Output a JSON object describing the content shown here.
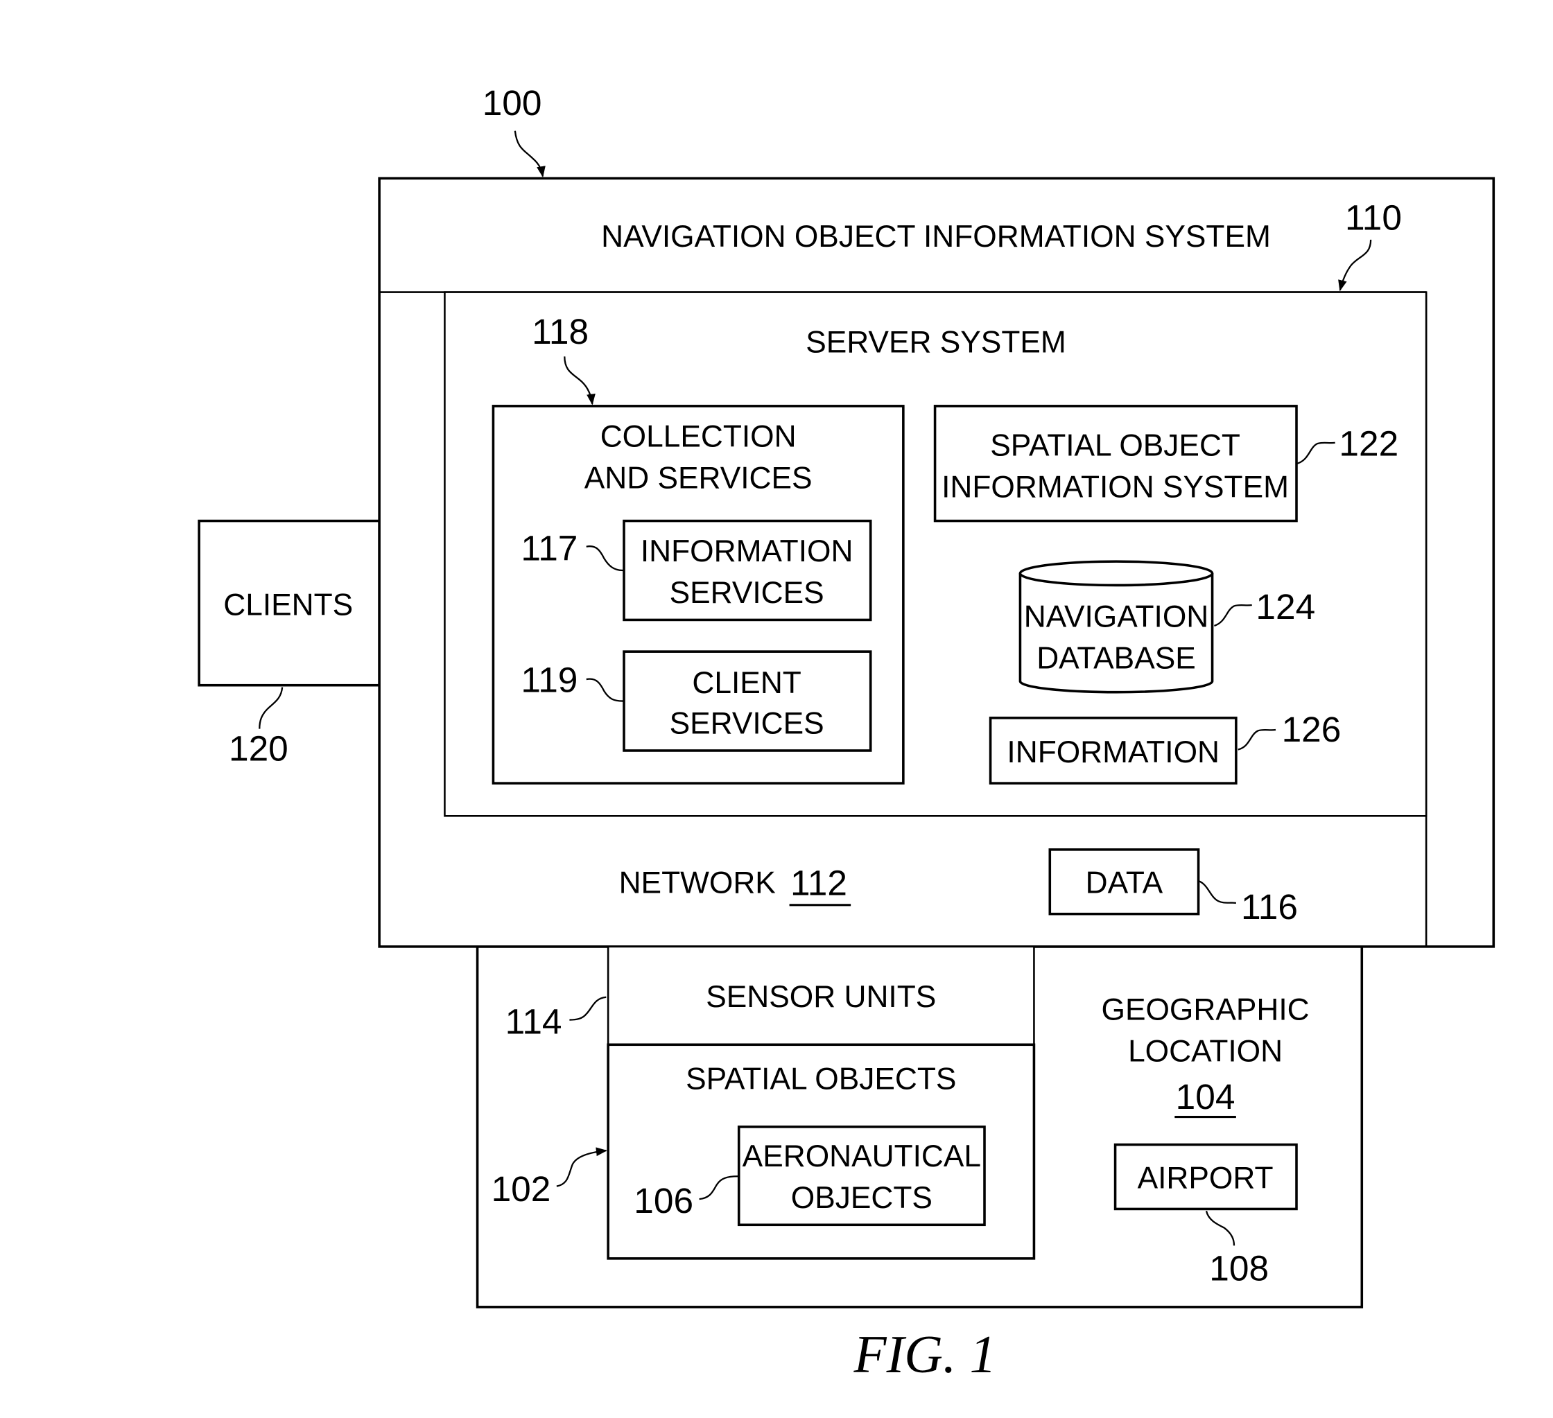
{
  "figure": {
    "caption": "FIG. 1",
    "reference": "100"
  },
  "nav_system": {
    "label": "NAVIGATION OBJECT INFORMATION SYSTEM",
    "ref": "100"
  },
  "server_system": {
    "label": "SERVER SYSTEM",
    "ref": "110"
  },
  "collection": {
    "line1": "COLLECTION",
    "line2": "AND SERVICES",
    "ref": "118"
  },
  "info_services": {
    "line1": "INFORMATION",
    "line2": "SERVICES",
    "ref": "117"
  },
  "client_services": {
    "line1": "CLIENT",
    "line2": "SERVICES",
    "ref": "119"
  },
  "spatial_info": {
    "line1": "SPATIAL OBJECT",
    "line2": "INFORMATION SYSTEM",
    "ref": "122"
  },
  "nav_db": {
    "line1": "NAVIGATION",
    "line2": "DATABASE",
    "ref": "124"
  },
  "information": {
    "label": "INFORMATION",
    "ref": "126"
  },
  "network": {
    "label": "NETWORK",
    "ref": "112"
  },
  "data": {
    "label": "DATA",
    "ref": "116"
  },
  "clients": {
    "label": "CLIENTS",
    "ref": "120"
  },
  "sensor_units": {
    "label": "SENSOR UNITS",
    "ref": "114"
  },
  "spatial_objects": {
    "label": "SPATIAL OBJECTS",
    "ref": "102"
  },
  "aero": {
    "line1": "AERONAUTICAL",
    "line2": "OBJECTS",
    "ref": "106"
  },
  "geo": {
    "line1": "GEOGRAPHIC",
    "line2": "LOCATION",
    "ref": "104"
  },
  "airport": {
    "label": "AIRPORT",
    "ref": "108"
  }
}
